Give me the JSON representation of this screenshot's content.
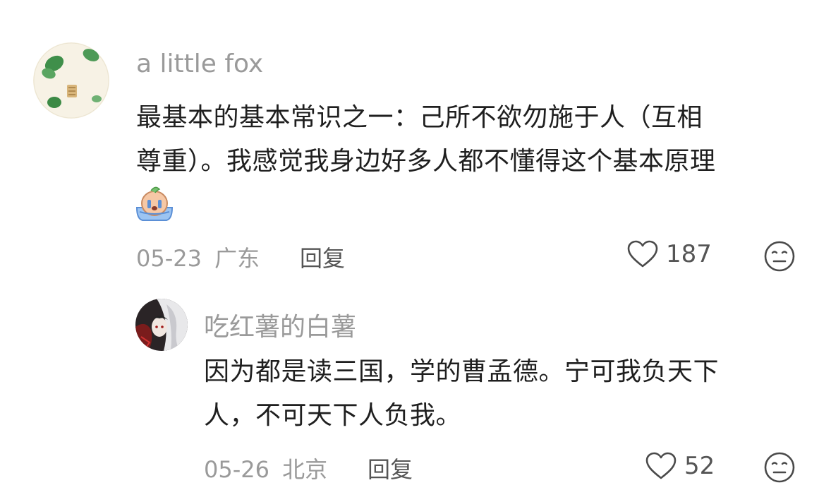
{
  "comments": [
    {
      "username": "a little fox",
      "content_lines": [
        "最基本的基本常识之一：己所不欲勿施于人（互相",
        "尊重）。我感觉我身边好多人都不懂得这个基本原理"
      ],
      "date": "05-23",
      "location": "广东",
      "reply_label": "回复",
      "likes": "187",
      "icons": {
        "avatar": "green-leaf-avatar",
        "sticker": "crying-emoji-icon",
        "like": "heart-outline-icon",
        "dislike": "meh-face-icon"
      }
    },
    {
      "username": "吃红薯的白薯",
      "content_lines": [
        "因为都是读三国，学的曹孟德。宁可我负天下",
        "人，不可天下人负我。"
      ],
      "date": "05-26",
      "location": "北京",
      "reply_label": "回复",
      "likes": "52",
      "icons": {
        "avatar": "anime-character-avatar",
        "like": "heart-outline-icon",
        "dislike": "meh-face-icon"
      }
    }
  ],
  "colors": {
    "text": "#1f1f1f",
    "muted": "#9a9a9a",
    "action": "#555555"
  }
}
